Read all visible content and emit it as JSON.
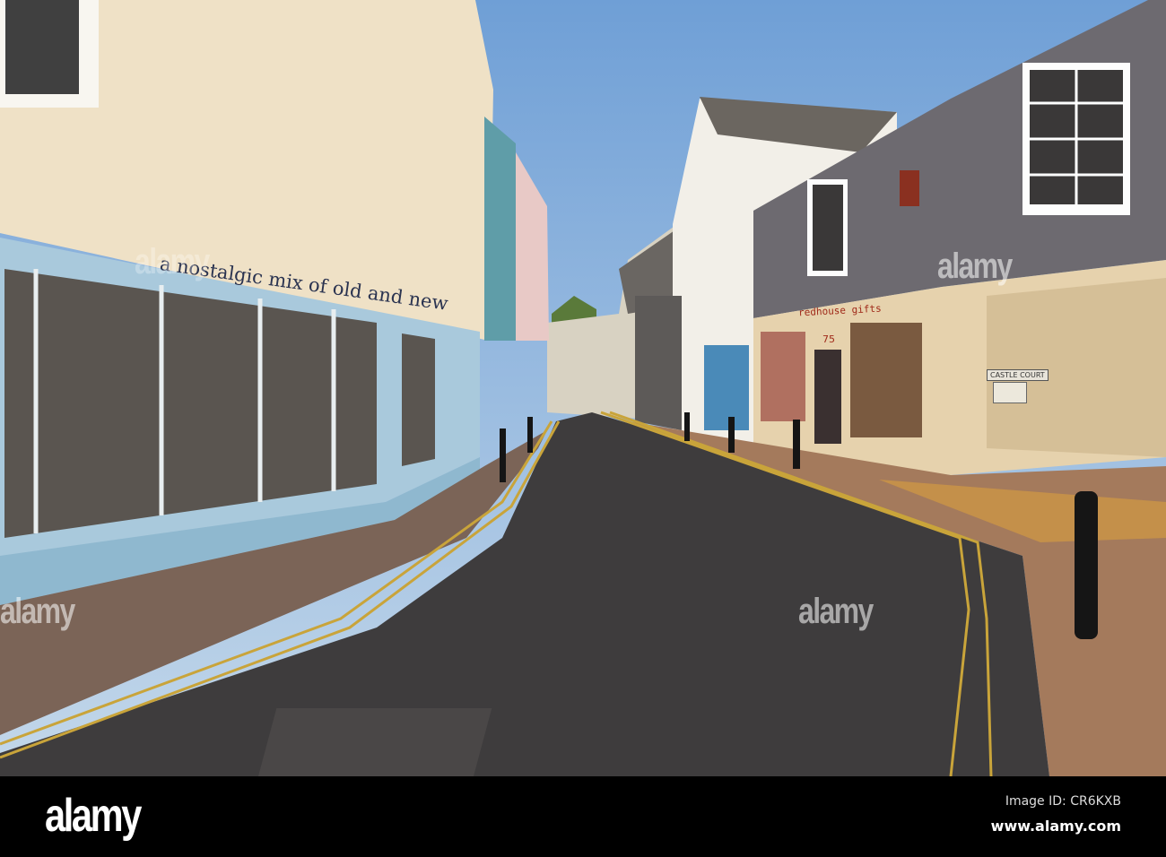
{
  "photo": {
    "shop_sign": "a nostalgic mix of old and new",
    "right_shop_sign": "redhouse gifts",
    "shop_number": "75",
    "street_sign": "CASTLE COURT"
  },
  "watermark": "alamy",
  "footer": {
    "logo": "alamy",
    "image_id": "Image ID: CR6KXB",
    "url": "www.alamy.com"
  },
  "colors": {
    "sky": "#8fb4dc",
    "road": "#3e3c3d",
    "yellow_lines": "#c9a43a",
    "footer": "#000000"
  }
}
